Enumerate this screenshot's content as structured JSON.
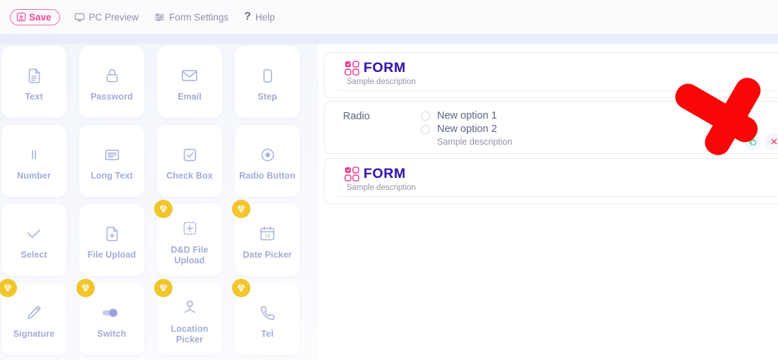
{
  "toolbar": {
    "save_label": "Save",
    "items": [
      {
        "label": "PC Preview",
        "icon": "monitor-icon"
      },
      {
        "label": "Form Settings",
        "icon": "sliders-icon"
      },
      {
        "label": "Help",
        "icon": "question-mark-icon"
      }
    ]
  },
  "sidebar": {
    "fields": [
      {
        "label": "Text",
        "icon": "document-text-icon",
        "premium": false
      },
      {
        "label": "Password",
        "icon": "lock-icon",
        "premium": false
      },
      {
        "label": "Email",
        "icon": "envelope-icon",
        "premium": false
      },
      {
        "label": "Step",
        "icon": "rounded-rect-icon",
        "premium": false
      },
      {
        "label": "Number",
        "icon": "number-bars-icon",
        "premium": false
      },
      {
        "label": "Long Text",
        "icon": "text-lines-icon",
        "premium": false
      },
      {
        "label": "Check Box",
        "icon": "checkbox-icon",
        "premium": false
      },
      {
        "label": "Radio Button",
        "icon": "radio-button-icon",
        "premium": false
      },
      {
        "label": "Select",
        "icon": "check-icon",
        "premium": false
      },
      {
        "label": "File Upload",
        "icon": "file-plus-icon",
        "premium": false
      },
      {
        "label": "D&D File Upload",
        "icon": "dashed-plus-icon",
        "premium": true
      },
      {
        "label": "Date Picker",
        "icon": "calendar-19-icon",
        "premium": true
      },
      {
        "label": "Signature",
        "icon": "pen-icon",
        "premium": true
      },
      {
        "label": "Switch",
        "icon": "toggle-switch-icon",
        "premium": true
      },
      {
        "label": "Location Picker",
        "icon": "location-pin-icon",
        "premium": true
      },
      {
        "label": "Tel",
        "icon": "phone-icon",
        "premium": true
      }
    ],
    "calendar_day": "19"
  },
  "preview": {
    "blocks": [
      {
        "type": "header",
        "title": "FORM",
        "description": "Sample description"
      },
      {
        "type": "radio",
        "label": "Radio",
        "options": [
          "New option 1",
          "New option 2"
        ],
        "description": "Sample description",
        "actions": [
          {
            "name": "duplicate-button",
            "icon": "copy-icon"
          },
          {
            "name": "delete-button",
            "icon": "close-icon"
          }
        ]
      },
      {
        "type": "header",
        "title": "FORM",
        "description": "Sample description"
      }
    ]
  },
  "annotation": {
    "arrow": "red-arrow-down-right",
    "color": "#f90606"
  },
  "colors": {
    "accent_pink": "#f4439a",
    "form_title_purple": "#3a1bb0",
    "premium_gold": "#f2c52b",
    "field_label": "#a4abd6",
    "delete_red": "#ef4056",
    "duplicate_green": "#35d07f"
  }
}
